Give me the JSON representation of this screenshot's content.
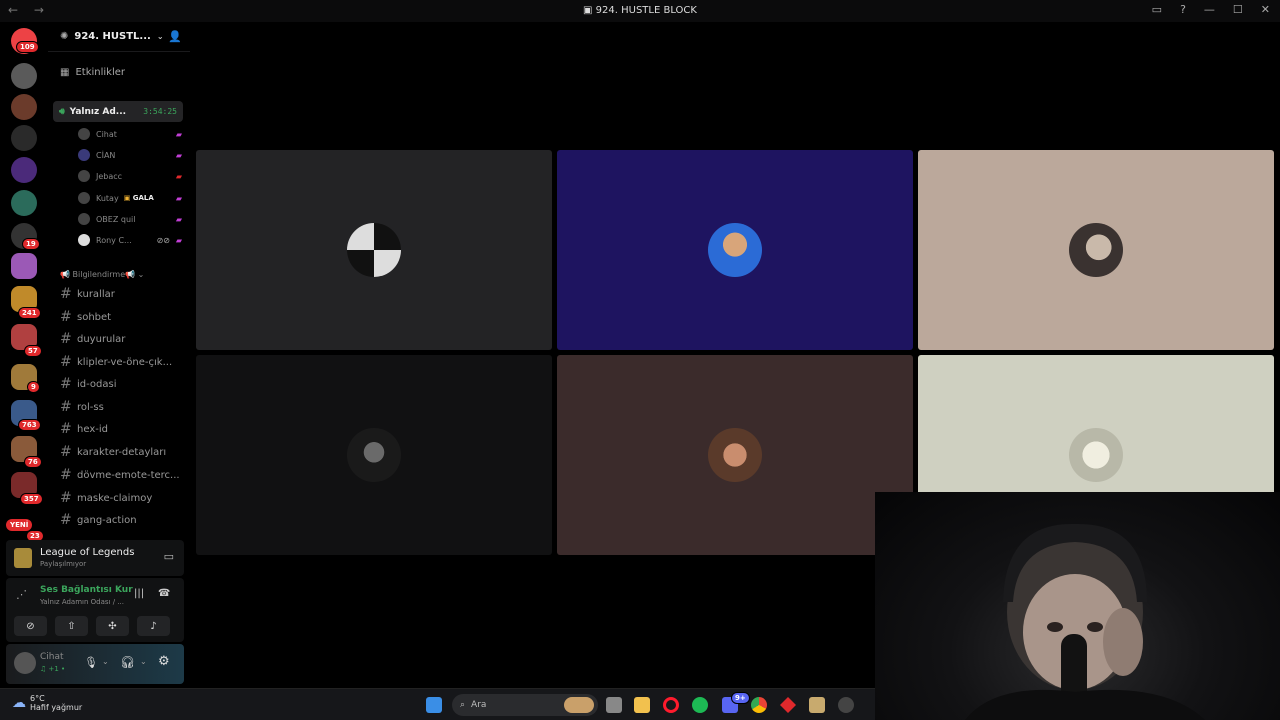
{
  "window": {
    "title": "924. HUSTLE BLOCK",
    "nav": "← →"
  },
  "rail": {
    "badges": [
      "109",
      "19",
      "241",
      "57",
      "9",
      "763",
      "76",
      "357",
      "23"
    ],
    "new_label": "YENİ"
  },
  "server": {
    "name": "924. HUSTL...",
    "chevron": "⌄"
  },
  "sidebar": {
    "events": "Etkinlikler",
    "voice_channel": {
      "name": "Yalnız Ad...",
      "timer": "3:54:25"
    },
    "voice_users": [
      {
        "name": "Cihat"
      },
      {
        "name": "CİAN"
      },
      {
        "name": "Jebacc"
      },
      {
        "name": "Kutay",
        "tag": "GALA"
      },
      {
        "name": "OBEZ quil"
      },
      {
        "name": "Rony C..."
      }
    ],
    "category": "📢 Bilgilendirme📢",
    "channels": [
      "kurallar",
      "sohbet",
      "duyurular",
      "klipler-ve-öne-çık...",
      "id-odasi",
      "rol-ss",
      "hex-id",
      "karakter-detayları",
      "dövme-emote-terc...",
      "maske-claimoy",
      "gang-action"
    ]
  },
  "activity": {
    "game": "League of Legends",
    "status": "Paylaşılmıyor"
  },
  "voice_status": {
    "label": "Ses Bağlantısı Kur",
    "location": "Yalnız Adamın Odası / ..."
  },
  "user": {
    "name": "Cihat",
    "status": "♫ +1 •"
  },
  "colors": {
    "accent": "#3ba55c",
    "tile_blue": "#1e1460",
    "tile_beige": "#bba89b",
    "tile_sage": "#cfd0c1",
    "tile_brown": "#3b2b2b"
  },
  "taskbar": {
    "temp": "6°C",
    "weather": "Hafif yağmur",
    "search": "Ara",
    "discord_badge": "9+"
  }
}
